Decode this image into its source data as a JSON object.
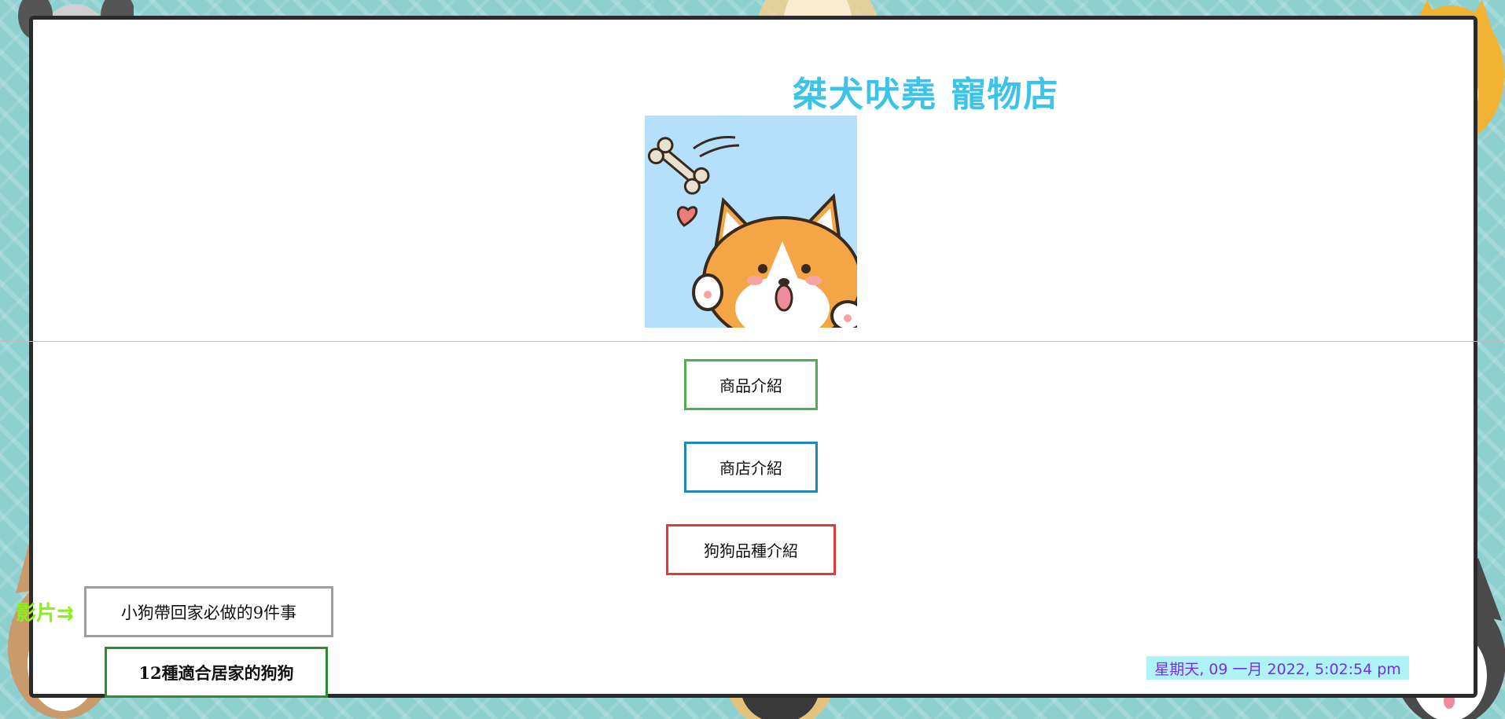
{
  "site": {
    "title": "桀犬吠堯 寵物店"
  },
  "nav": {
    "products": "商品介紹",
    "store": "商店介紹",
    "breeds": "狗狗品種介紹"
  },
  "videos": {
    "label": "影片⇉",
    "items": [
      "小狗帶回家必做的9件事",
      "12種適合居家的狗狗"
    ]
  },
  "clock": {
    "text": "星期天, 09 一月 2022, 5:02:54 pm"
  },
  "colors": {
    "title": "#3cc3ea",
    "border_bg": "#8ecfd0",
    "products_border": "#4caf50",
    "store_border": "#1e88b8",
    "breeds_border": "#e53935",
    "video_label": "#8bef1c",
    "clock_bg": "#aef3f6",
    "clock_text": "#7a2cf0"
  }
}
